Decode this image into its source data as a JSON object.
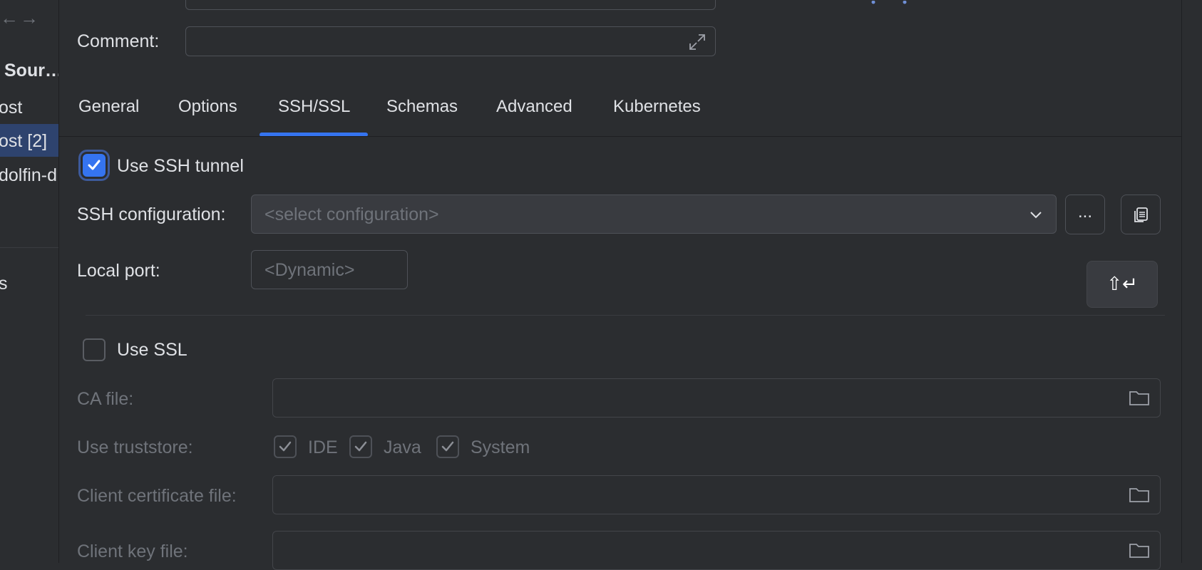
{
  "sidebar": {
    "nav_back": "←",
    "nav_forward": "→",
    "section_title": "Sour…",
    "items": [
      "ost",
      "ost [2]",
      "dolfin-d"
    ],
    "bottom_item": "s"
  },
  "form_top": {
    "comment_label": "Comment:"
  },
  "tabs": [
    "General",
    "Options",
    "SSH/SSL",
    "Schemas",
    "Advanced",
    "Kubernetes"
  ],
  "active_tab": "SSH/SSL",
  "ssh": {
    "use_ssh_tunnel_label": "Use SSH tunnel",
    "use_ssh_tunnel_checked": true,
    "configuration_label": "SSH configuration:",
    "configuration_placeholder": "<select configuration>",
    "browse_button_label": "...",
    "local_port_label": "Local port:",
    "local_port_placeholder": "<Dynamic>",
    "shortcut_hint": "⇧↵"
  },
  "ssl": {
    "use_ssl_label": "Use SSL",
    "use_ssl_checked": false,
    "ca_file_label": "CA file:",
    "truststore_label": "Use truststore:",
    "truststore_options": [
      {
        "label": "IDE",
        "checked": true
      },
      {
        "label": "Java",
        "checked": true
      },
      {
        "label": "System",
        "checked": true
      }
    ],
    "client_cert_label": "Client certificate file:",
    "client_key_label": "Client key file:"
  },
  "colors": {
    "accent": "#3574f0",
    "background": "#2b2d30",
    "selection": "#2e436e"
  }
}
